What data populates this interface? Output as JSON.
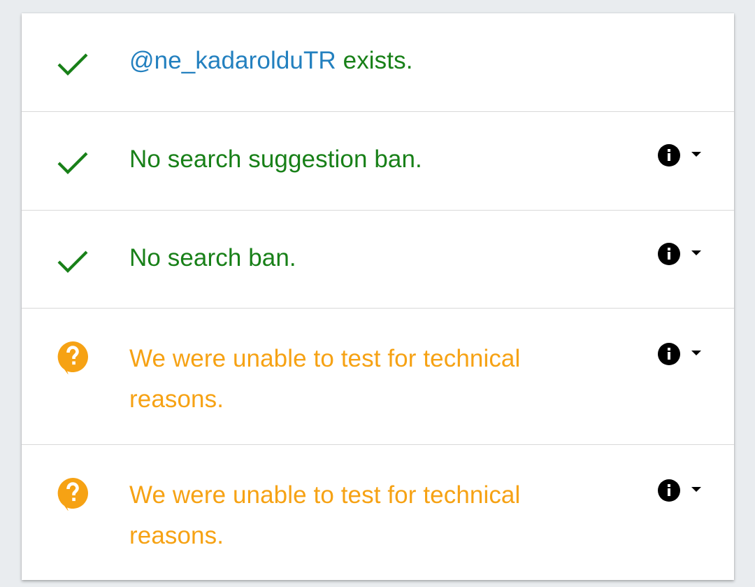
{
  "results": [
    {
      "status": "ok",
      "icon": "checkmark-icon",
      "handle": "@ne_kadarolduTR",
      "text": " exists.",
      "has_actions": false
    },
    {
      "status": "ok",
      "icon": "checkmark-icon",
      "text": "No search suggestion ban.",
      "has_actions": true
    },
    {
      "status": "ok",
      "icon": "checkmark-icon",
      "text": "No search ban.",
      "has_actions": true
    },
    {
      "status": "unknown",
      "icon": "question-bubble-icon",
      "text": "We were unable to test for technical reasons.",
      "has_actions": true
    },
    {
      "status": "unknown",
      "icon": "question-bubble-icon",
      "text": "We were unable to test for technical reasons.",
      "has_actions": true
    }
  ],
  "colors": {
    "ok": "#188018",
    "warning": "#f6a214",
    "handle": "#2380bf",
    "icon_dark": "#000000",
    "background": "#e9ecef",
    "card": "#ffffff"
  }
}
